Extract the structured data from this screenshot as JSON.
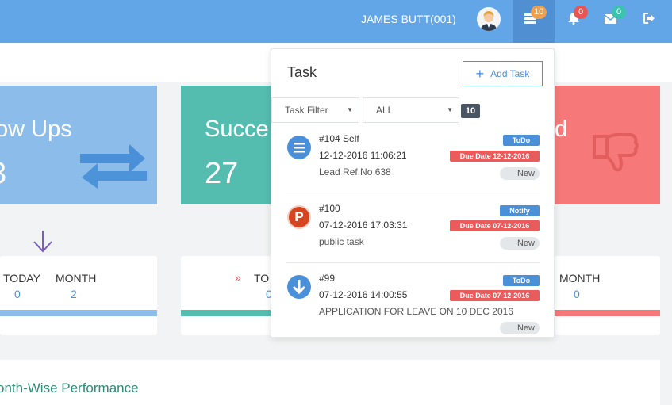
{
  "header": {
    "user_name": "JAMES BUTT(001)",
    "task_count": "10",
    "notification_count": "0",
    "message_count": "0",
    "colors": {
      "bar": "#62a6e8",
      "task_badge": "#f0a04b",
      "notify_badge": "#e95555",
      "message_badge": "#3cc3b0"
    }
  },
  "cards": [
    {
      "title": "ow Ups",
      "value": "3",
      "color": "#8bbcea",
      "icon": "exchange-arrows-icon"
    },
    {
      "title": "Succe",
      "value": "27",
      "color": "#55bdb0"
    },
    {
      "title": "d",
      "value": "",
      "color": "#f67878",
      "icon": "thumbs-down-icon"
    }
  ],
  "stats": [
    {
      "today_label": "TODAY",
      "today_value": "0",
      "month_label": "MONTH",
      "month_value": "2",
      "bar_color": "#8bbcea"
    },
    {
      "today_label": "TO",
      "today_value": "0",
      "bar_color": "#55bdb0"
    },
    {
      "month_label": "MONTH",
      "month_value": "0",
      "bar_color": "#f67878"
    }
  ],
  "performance": {
    "title": "onth-Wise Performance"
  },
  "task_panel": {
    "title": "Task",
    "add_label": "Add Task",
    "filter_label": "Task Filter",
    "all_label": "ALL",
    "count": "10",
    "tasks": [
      {
        "id": "#104 Self",
        "datetime": "12-12-2016 11:06:21",
        "desc": "Lead Ref.No 638",
        "type": "ToDo",
        "due": "Due Date  12-12-2016",
        "status": "New",
        "icon": "list-icon",
        "icon_glyph": "☰",
        "icon_color": "#4a90d9",
        "type_color": "#4a90d9"
      },
      {
        "id": "#100",
        "datetime": "07-12-2016 17:03:31",
        "desc": "public task",
        "type": "Notify",
        "due": "Due Date  07-12-2016",
        "status": "New",
        "icon": "pinterest-p-icon",
        "icon_glyph": "P",
        "icon_color": "#d6451f",
        "type_color": "#4a90d9"
      },
      {
        "id": "#99",
        "datetime": "07-12-2016 14:00:55",
        "desc": "APPLICATION FOR LEAVE ON 10 DEC 2016",
        "type": "ToDo",
        "due": "Due Date  07-12-2016",
        "status": "New",
        "icon": "download-arrow-icon",
        "icon_glyph": "↓",
        "icon_color": "#4a90d9",
        "type_color": "#4a90d9"
      }
    ],
    "due_color": "#ea5b5b"
  }
}
